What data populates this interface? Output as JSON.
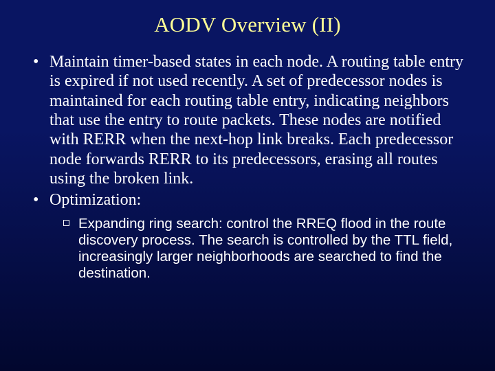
{
  "slide": {
    "title": "AODV Overview (II)",
    "bullets": [
      {
        "text": "Maintain timer-based states in each node. A routing table entry is expired if not used recently. A set of predecessor nodes is maintained for each routing table entry, indicating neighbors that use the entry to route packets. These nodes are notified with RERR when the next-hop link breaks. Each predecessor node forwards RERR to its predecessors, erasing all routes using the broken link."
      },
      {
        "text": "Optimization:",
        "sub": [
          {
            "text": "Expanding ring search: control the RREQ flood in the route discovery process. The search is controlled by the TTL field, increasingly larger neighborhoods are searched to find the destination."
          }
        ]
      }
    ]
  }
}
